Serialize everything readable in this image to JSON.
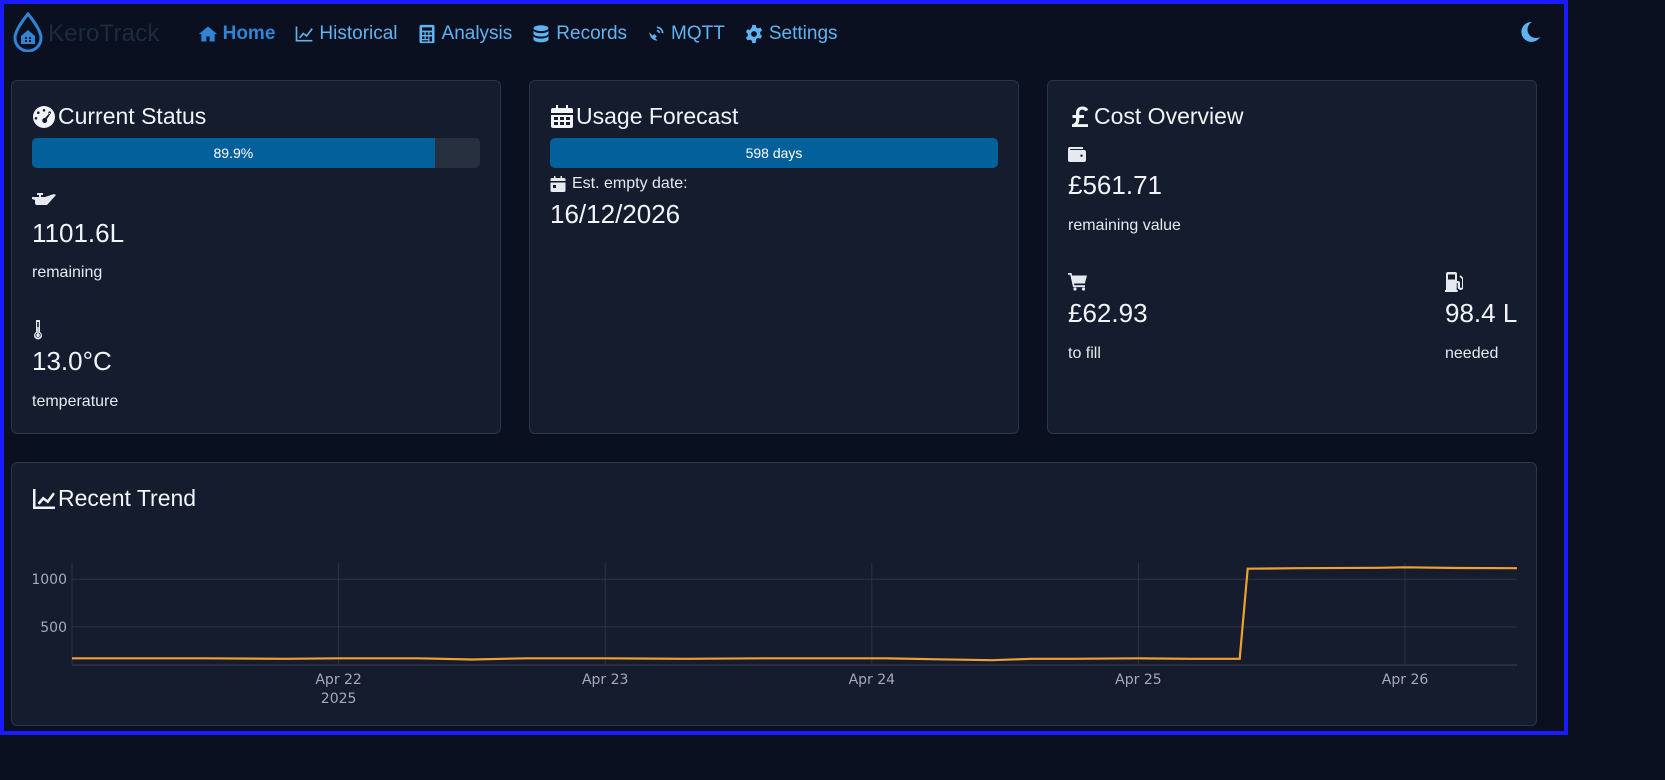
{
  "brand": {
    "name": "KeroTrack",
    "icon": "droplet-house-icon"
  },
  "nav": {
    "home": "Home",
    "historical": "Historical",
    "analysis": "Analysis",
    "records": "Records",
    "mqtt": "MQTT",
    "settings": "Settings"
  },
  "status": {
    "title": "Current Status",
    "percent": 89.9,
    "percent_label": "89.9%",
    "level_value": "1101.6L",
    "level_label": "remaining",
    "temp_value": "13.0°C",
    "temp_label": "temperature"
  },
  "forecast": {
    "title": "Usage Forecast",
    "days_label": "598 days",
    "days_fraction": 1.0,
    "empty_label": "Est. empty date:",
    "empty_date": "16/12/2026"
  },
  "cost": {
    "title": "Cost Overview",
    "remaining_value": "£561.71",
    "remaining_label": "remaining value",
    "fill_value": "£62.93",
    "fill_label": "to fill",
    "needed_value": "98.4 L",
    "needed_label": "needed"
  },
  "trend": {
    "title": "Recent Trend"
  },
  "colors": {
    "accent": "#5fb3f0",
    "progress": "#03609a",
    "line": "#f0a030",
    "frame": "#1a1aff"
  },
  "chart_data": {
    "type": "line",
    "title": "Recent Trend",
    "x_ticks": [
      "Apr 22",
      "Apr 23",
      "Apr 24",
      "Apr 25",
      "Apr 26"
    ],
    "x_year": "2025",
    "y_ticks": [
      500,
      1000
    ],
    "ylim": [
      100,
      1170
    ],
    "xlim": [
      21.0,
      26.42
    ],
    "grid": true,
    "series": [
      {
        "values": [
          [
            21.0,
            170
          ],
          [
            21.5,
            170
          ],
          [
            21.8,
            165
          ],
          [
            22.0,
            170
          ],
          [
            22.3,
            170
          ],
          [
            22.5,
            158
          ],
          [
            22.7,
            170
          ],
          [
            23.0,
            170
          ],
          [
            23.3,
            165
          ],
          [
            23.6,
            170
          ],
          [
            23.9,
            170
          ],
          [
            24.05,
            170
          ],
          [
            24.25,
            160
          ],
          [
            24.45,
            150
          ],
          [
            24.6,
            165
          ],
          [
            24.75,
            165
          ],
          [
            25.0,
            170
          ],
          [
            25.2,
            165
          ],
          [
            25.38,
            165
          ],
          [
            25.41,
            1110
          ],
          [
            25.6,
            1115
          ],
          [
            25.9,
            1120
          ],
          [
            26.0,
            1125
          ],
          [
            26.2,
            1118
          ],
          [
            26.42,
            1115
          ]
        ]
      }
    ]
  }
}
